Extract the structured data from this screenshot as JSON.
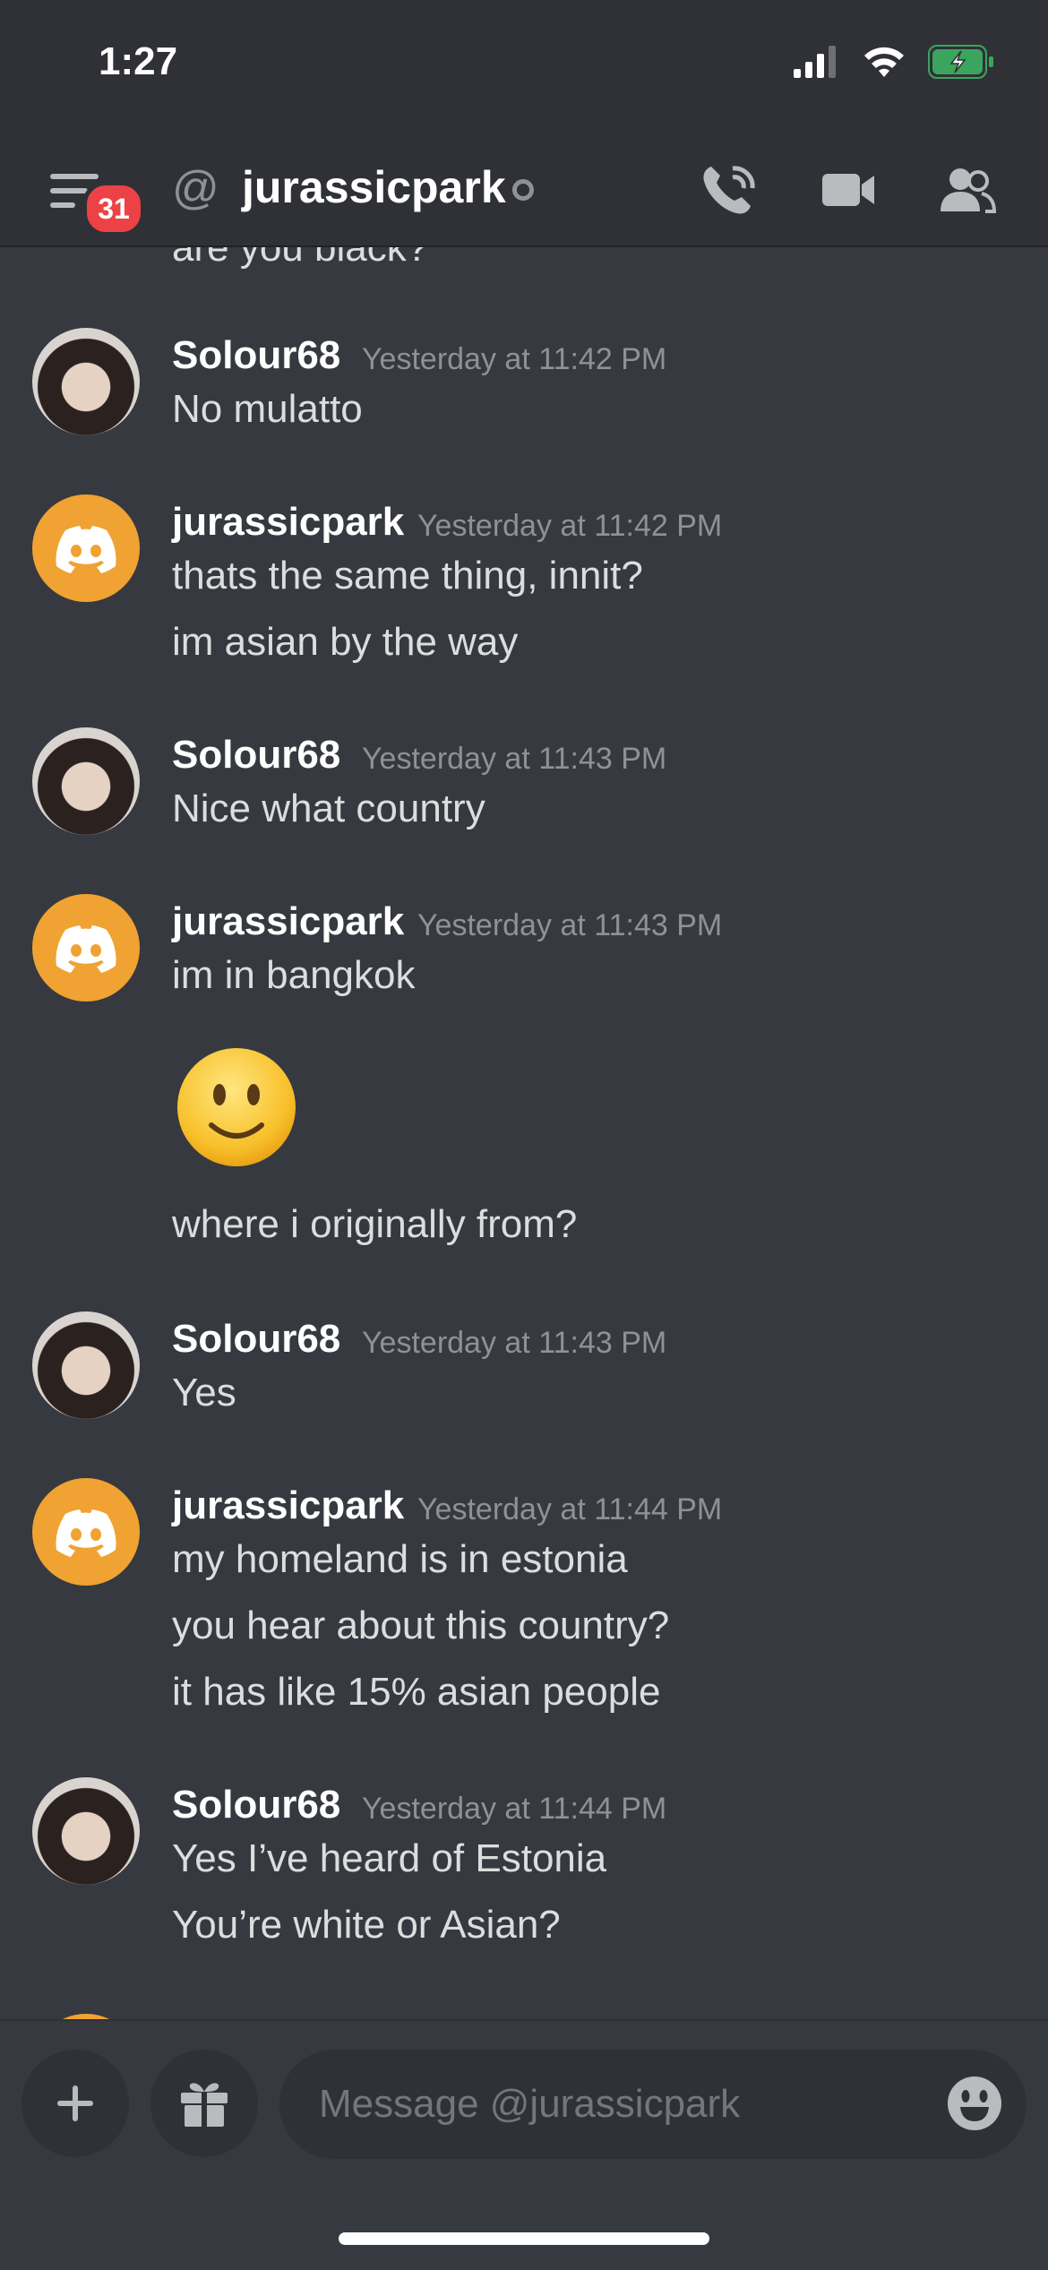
{
  "status_bar": {
    "time": "1:27"
  },
  "header": {
    "badge_count": "31",
    "channel_name": "jurassicpark",
    "icons": [
      "hamburger-menu-icon",
      "at-icon",
      "phone-call-icon",
      "video-camera-icon",
      "members-icon"
    ]
  },
  "messages": {
    "partial_top": "are you black?",
    "m1": {
      "author": "Solour68",
      "timestamp": "Yesterday at 11:42 PM",
      "lines": [
        "No mulatto"
      ]
    },
    "m2": {
      "author": "jurassicpark",
      "timestamp": "Yesterday at 11:42 PM",
      "lines": [
        "thats the same thing, innit?",
        "im asian by the way"
      ]
    },
    "m3": {
      "author": "Solour68",
      "timestamp": "Yesterday at 11:43 PM",
      "lines": [
        "Nice what country"
      ]
    },
    "m4": {
      "author": "jurassicpark",
      "timestamp": "Yesterday at 11:43 PM",
      "lines": [
        "im in bangkok",
        "where i originally from?"
      ],
      "emoji": "slightly-smiling-face"
    },
    "m5": {
      "author": "Solour68",
      "timestamp": "Yesterday at 11:43 PM",
      "lines": [
        "Yes"
      ]
    },
    "m6": {
      "author": "jurassicpark",
      "timestamp": "Yesterday at 11:44 PM",
      "lines": [
        "my homeland is in estonia",
        "you hear about this country?",
        "it has like 15% asian people"
      ]
    },
    "m7": {
      "author": "Solour68",
      "timestamp": "Yesterday at 11:44 PM",
      "lines": [
        "Yes I’ve heard of Estonia",
        "You’re white or Asian?"
      ]
    }
  },
  "composer": {
    "placeholder": "Message @jurassicpark"
  },
  "colors": {
    "background": "#36393f",
    "header": "#2f3136",
    "badge": "#ed4245",
    "discord_avatar": "#f0a232",
    "battery": "#3ba55d"
  }
}
